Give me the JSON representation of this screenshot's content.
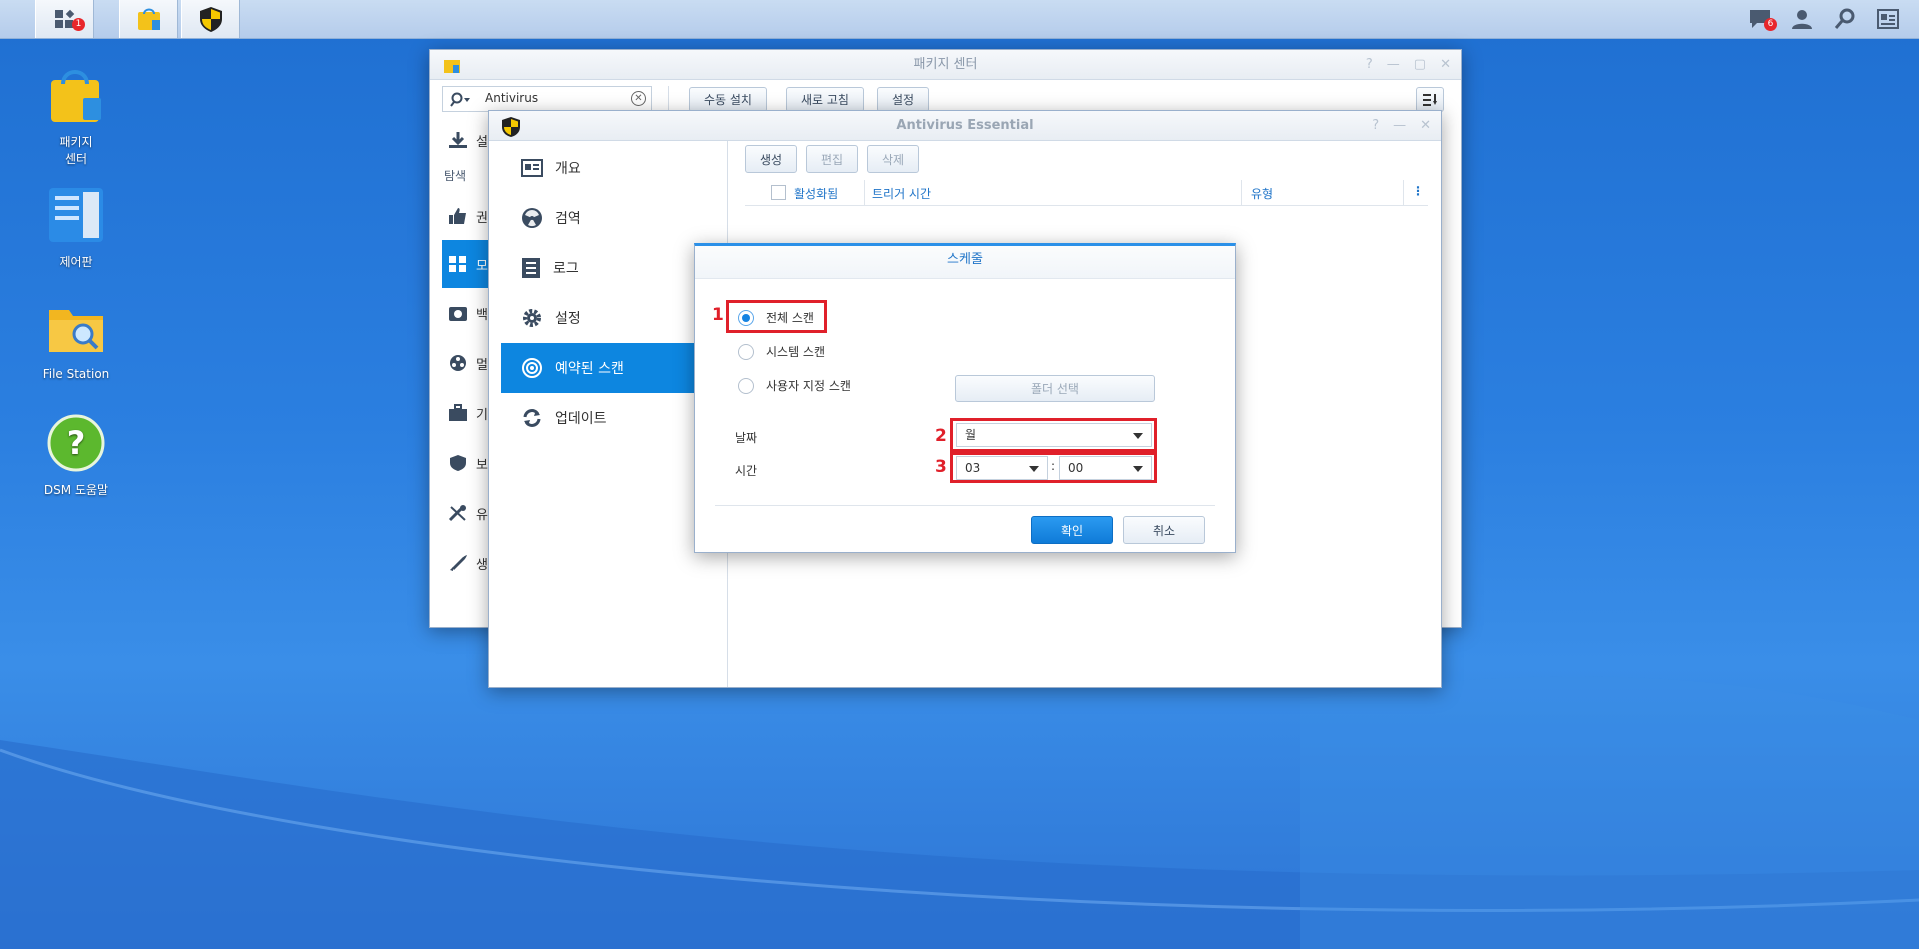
{
  "taskbar": {
    "main_menu_badge": "1",
    "notifications_badge": "6"
  },
  "desktop": {
    "icons": [
      {
        "label": "패키지\n센터"
      },
      {
        "label": "제어판"
      },
      {
        "label": "File Station"
      },
      {
        "label": "DSM 도움말"
      }
    ]
  },
  "package_center": {
    "title": "패키지 센터",
    "search_value": "Antivirus",
    "toolbar": {
      "manual_install": "수동 설치",
      "refresh": "새로 고침",
      "settings": "설정"
    },
    "sidebar": {
      "item1": "설",
      "section_explore": "탐색",
      "item2": "권",
      "item3": "모",
      "item4": "백",
      "item5": "멀",
      "item6": "기",
      "item7": "보",
      "item8": "유",
      "item9": "생"
    }
  },
  "antivirus": {
    "title": "Antivirus Essential",
    "nav": [
      {
        "label": "개요"
      },
      {
        "label": "검역"
      },
      {
        "label": "로그"
      },
      {
        "label": "설정"
      },
      {
        "label": "예약된 스캔"
      },
      {
        "label": "업데이트"
      }
    ],
    "toolbar": {
      "create": "생성",
      "edit": "편집",
      "delete": "삭제"
    },
    "table_headers": {
      "enabled": "활성화됨",
      "trigger_time": "트리거 시간",
      "type": "유형"
    }
  },
  "schedule_dialog": {
    "title": "스케줄",
    "options": {
      "full_scan": "전체 스캔",
      "system_scan": "시스템 스캔",
      "custom_scan": "사용자 지정 스캔"
    },
    "folder_select": "폴더 선택",
    "date_label": "날짜",
    "date_value": "월",
    "time_label": "시간",
    "hour_value": "03",
    "minute_value": "00",
    "time_sep": ":",
    "ok": "확인",
    "cancel": "취소"
  },
  "annotations": {
    "n1": "1",
    "n2": "2",
    "n3": "3"
  },
  "colors": {
    "accent": "#0d86e0",
    "highlight": "#e0202a"
  }
}
